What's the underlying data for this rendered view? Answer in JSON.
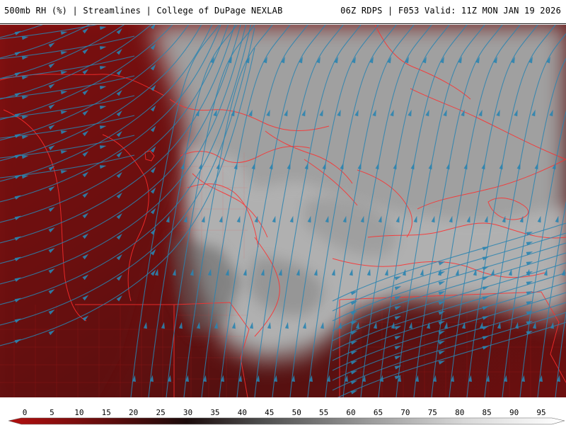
{
  "header": {
    "left_text": "500mb RH (%) | Streamlines | College of DuPage NEXLAB",
    "right_text": "06Z RDPS | F053 Valid: 11Z MON JAN 19 2026"
  },
  "legend": {
    "ticks": [
      "0",
      "5",
      "10",
      "15",
      "20",
      "25",
      "30",
      "35",
      "40",
      "45",
      "50",
      "55",
      "60",
      "65",
      "70",
      "75",
      "80",
      "85",
      "90",
      "95"
    ]
  },
  "colors": {
    "dry_red": "#7c1010",
    "dark_red": "#3a0a0a",
    "moist_gray": "#8f8f8f",
    "light_gray": "#b8b8b8",
    "boundary_red": "#ff2a2a",
    "streamline_blue": "#2a84b0"
  }
}
